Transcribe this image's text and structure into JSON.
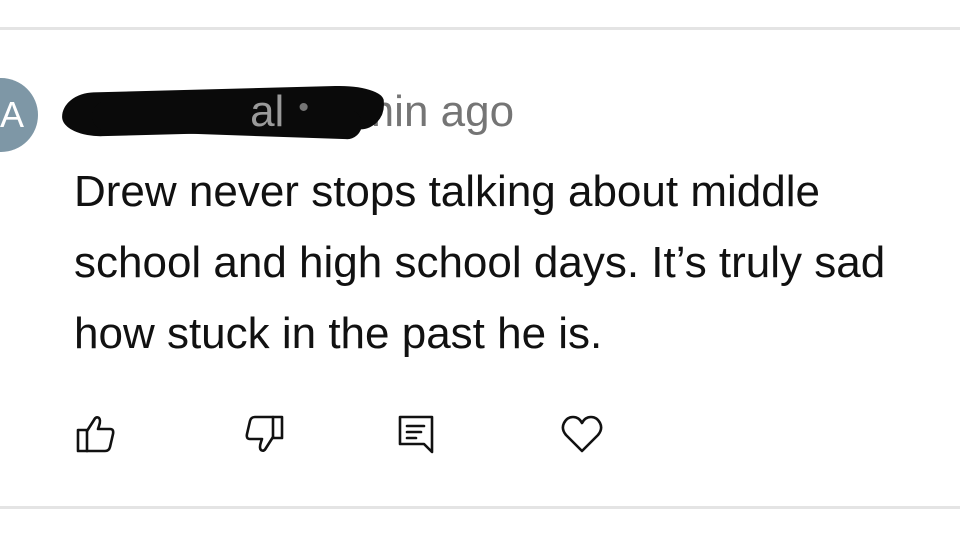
{
  "comment": {
    "avatar_letter": "A",
    "author_visible_tail": "al",
    "separator": "•",
    "timestamp": "4 min ago",
    "text": "Drew never stops talking about middle school and high school days. It’s truly sad how stuck in the past he is."
  },
  "actions": {
    "icons": [
      "thumbs-up-icon",
      "thumbs-down-icon",
      "reply-icon",
      "heart-icon"
    ]
  },
  "colors": {
    "avatar": "#7e97a6",
    "meta_text": "#757575",
    "body_text": "#111111",
    "divider": "#e4e4e4"
  }
}
